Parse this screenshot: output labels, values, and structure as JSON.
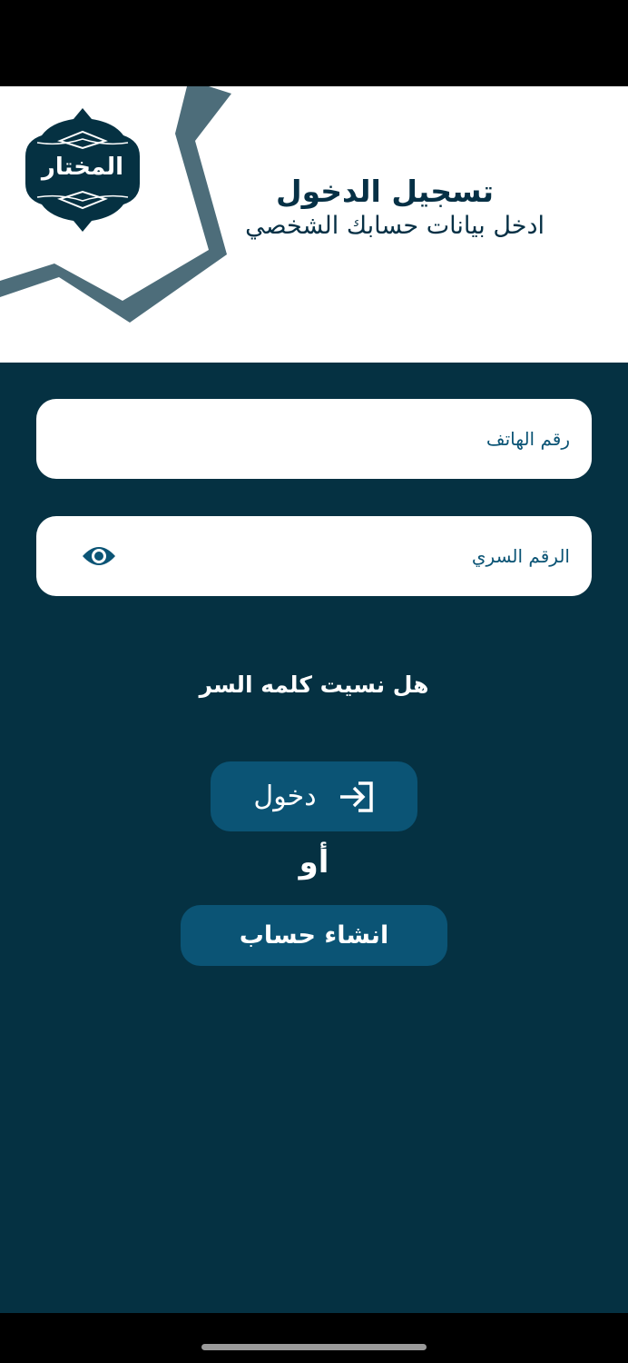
{
  "header": {
    "logo_text": "المختار",
    "title": "تسجيل الدخول",
    "subtitle": "ادخل بيانات حسابك الشخصي"
  },
  "form": {
    "phone_placeholder": "رقم الهاتف",
    "password_placeholder": "الرقم السري",
    "forgot_password": "هل نسيت كلمه السر",
    "login_button": "دخول",
    "or": "أو",
    "register_button": "انشاء حساب"
  },
  "icons": {
    "eye": "eye-icon",
    "login": "login-arrow-icon"
  },
  "colors": {
    "primary_dark": "#053142",
    "accent": "#0b5475",
    "star_decor": "#4d6d7a",
    "header_bg": "#ffffff"
  }
}
